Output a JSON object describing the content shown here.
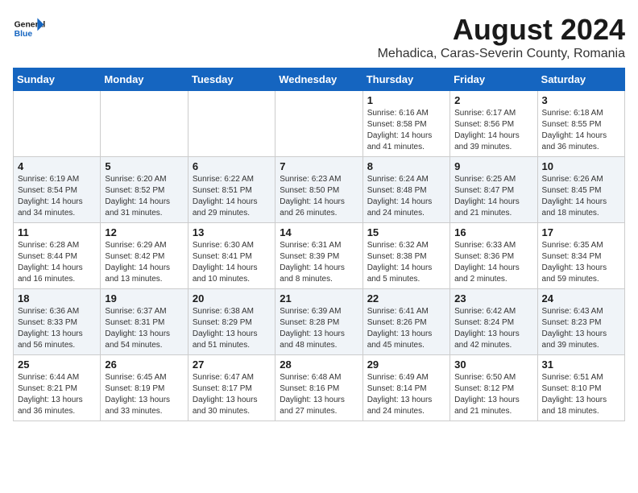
{
  "header": {
    "logo_general": "General",
    "logo_blue": "Blue",
    "title": "August 2024",
    "subtitle": "Mehadica, Caras-Severin County, Romania"
  },
  "calendar": {
    "days_of_week": [
      "Sunday",
      "Monday",
      "Tuesday",
      "Wednesday",
      "Thursday",
      "Friday",
      "Saturday"
    ],
    "weeks": [
      [
        {
          "day": "",
          "info": ""
        },
        {
          "day": "",
          "info": ""
        },
        {
          "day": "",
          "info": ""
        },
        {
          "day": "",
          "info": ""
        },
        {
          "day": "1",
          "info": "Sunrise: 6:16 AM\nSunset: 8:58 PM\nDaylight: 14 hours and 41 minutes."
        },
        {
          "day": "2",
          "info": "Sunrise: 6:17 AM\nSunset: 8:56 PM\nDaylight: 14 hours and 39 minutes."
        },
        {
          "day": "3",
          "info": "Sunrise: 6:18 AM\nSunset: 8:55 PM\nDaylight: 14 hours and 36 minutes."
        }
      ],
      [
        {
          "day": "4",
          "info": "Sunrise: 6:19 AM\nSunset: 8:54 PM\nDaylight: 14 hours and 34 minutes."
        },
        {
          "day": "5",
          "info": "Sunrise: 6:20 AM\nSunset: 8:52 PM\nDaylight: 14 hours and 31 minutes."
        },
        {
          "day": "6",
          "info": "Sunrise: 6:22 AM\nSunset: 8:51 PM\nDaylight: 14 hours and 29 minutes."
        },
        {
          "day": "7",
          "info": "Sunrise: 6:23 AM\nSunset: 8:50 PM\nDaylight: 14 hours and 26 minutes."
        },
        {
          "day": "8",
          "info": "Sunrise: 6:24 AM\nSunset: 8:48 PM\nDaylight: 14 hours and 24 minutes."
        },
        {
          "day": "9",
          "info": "Sunrise: 6:25 AM\nSunset: 8:47 PM\nDaylight: 14 hours and 21 minutes."
        },
        {
          "day": "10",
          "info": "Sunrise: 6:26 AM\nSunset: 8:45 PM\nDaylight: 14 hours and 18 minutes."
        }
      ],
      [
        {
          "day": "11",
          "info": "Sunrise: 6:28 AM\nSunset: 8:44 PM\nDaylight: 14 hours and 16 minutes."
        },
        {
          "day": "12",
          "info": "Sunrise: 6:29 AM\nSunset: 8:42 PM\nDaylight: 14 hours and 13 minutes."
        },
        {
          "day": "13",
          "info": "Sunrise: 6:30 AM\nSunset: 8:41 PM\nDaylight: 14 hours and 10 minutes."
        },
        {
          "day": "14",
          "info": "Sunrise: 6:31 AM\nSunset: 8:39 PM\nDaylight: 14 hours and 8 minutes."
        },
        {
          "day": "15",
          "info": "Sunrise: 6:32 AM\nSunset: 8:38 PM\nDaylight: 14 hours and 5 minutes."
        },
        {
          "day": "16",
          "info": "Sunrise: 6:33 AM\nSunset: 8:36 PM\nDaylight: 14 hours and 2 minutes."
        },
        {
          "day": "17",
          "info": "Sunrise: 6:35 AM\nSunset: 8:34 PM\nDaylight: 13 hours and 59 minutes."
        }
      ],
      [
        {
          "day": "18",
          "info": "Sunrise: 6:36 AM\nSunset: 8:33 PM\nDaylight: 13 hours and 56 minutes."
        },
        {
          "day": "19",
          "info": "Sunrise: 6:37 AM\nSunset: 8:31 PM\nDaylight: 13 hours and 54 minutes."
        },
        {
          "day": "20",
          "info": "Sunrise: 6:38 AM\nSunset: 8:29 PM\nDaylight: 13 hours and 51 minutes."
        },
        {
          "day": "21",
          "info": "Sunrise: 6:39 AM\nSunset: 8:28 PM\nDaylight: 13 hours and 48 minutes."
        },
        {
          "day": "22",
          "info": "Sunrise: 6:41 AM\nSunset: 8:26 PM\nDaylight: 13 hours and 45 minutes."
        },
        {
          "day": "23",
          "info": "Sunrise: 6:42 AM\nSunset: 8:24 PM\nDaylight: 13 hours and 42 minutes."
        },
        {
          "day": "24",
          "info": "Sunrise: 6:43 AM\nSunset: 8:23 PM\nDaylight: 13 hours and 39 minutes."
        }
      ],
      [
        {
          "day": "25",
          "info": "Sunrise: 6:44 AM\nSunset: 8:21 PM\nDaylight: 13 hours and 36 minutes."
        },
        {
          "day": "26",
          "info": "Sunrise: 6:45 AM\nSunset: 8:19 PM\nDaylight: 13 hours and 33 minutes."
        },
        {
          "day": "27",
          "info": "Sunrise: 6:47 AM\nSunset: 8:17 PM\nDaylight: 13 hours and 30 minutes."
        },
        {
          "day": "28",
          "info": "Sunrise: 6:48 AM\nSunset: 8:16 PM\nDaylight: 13 hours and 27 minutes."
        },
        {
          "day": "29",
          "info": "Sunrise: 6:49 AM\nSunset: 8:14 PM\nDaylight: 13 hours and 24 minutes."
        },
        {
          "day": "30",
          "info": "Sunrise: 6:50 AM\nSunset: 8:12 PM\nDaylight: 13 hours and 21 minutes."
        },
        {
          "day": "31",
          "info": "Sunrise: 6:51 AM\nSunset: 8:10 PM\nDaylight: 13 hours and 18 minutes."
        }
      ]
    ]
  }
}
